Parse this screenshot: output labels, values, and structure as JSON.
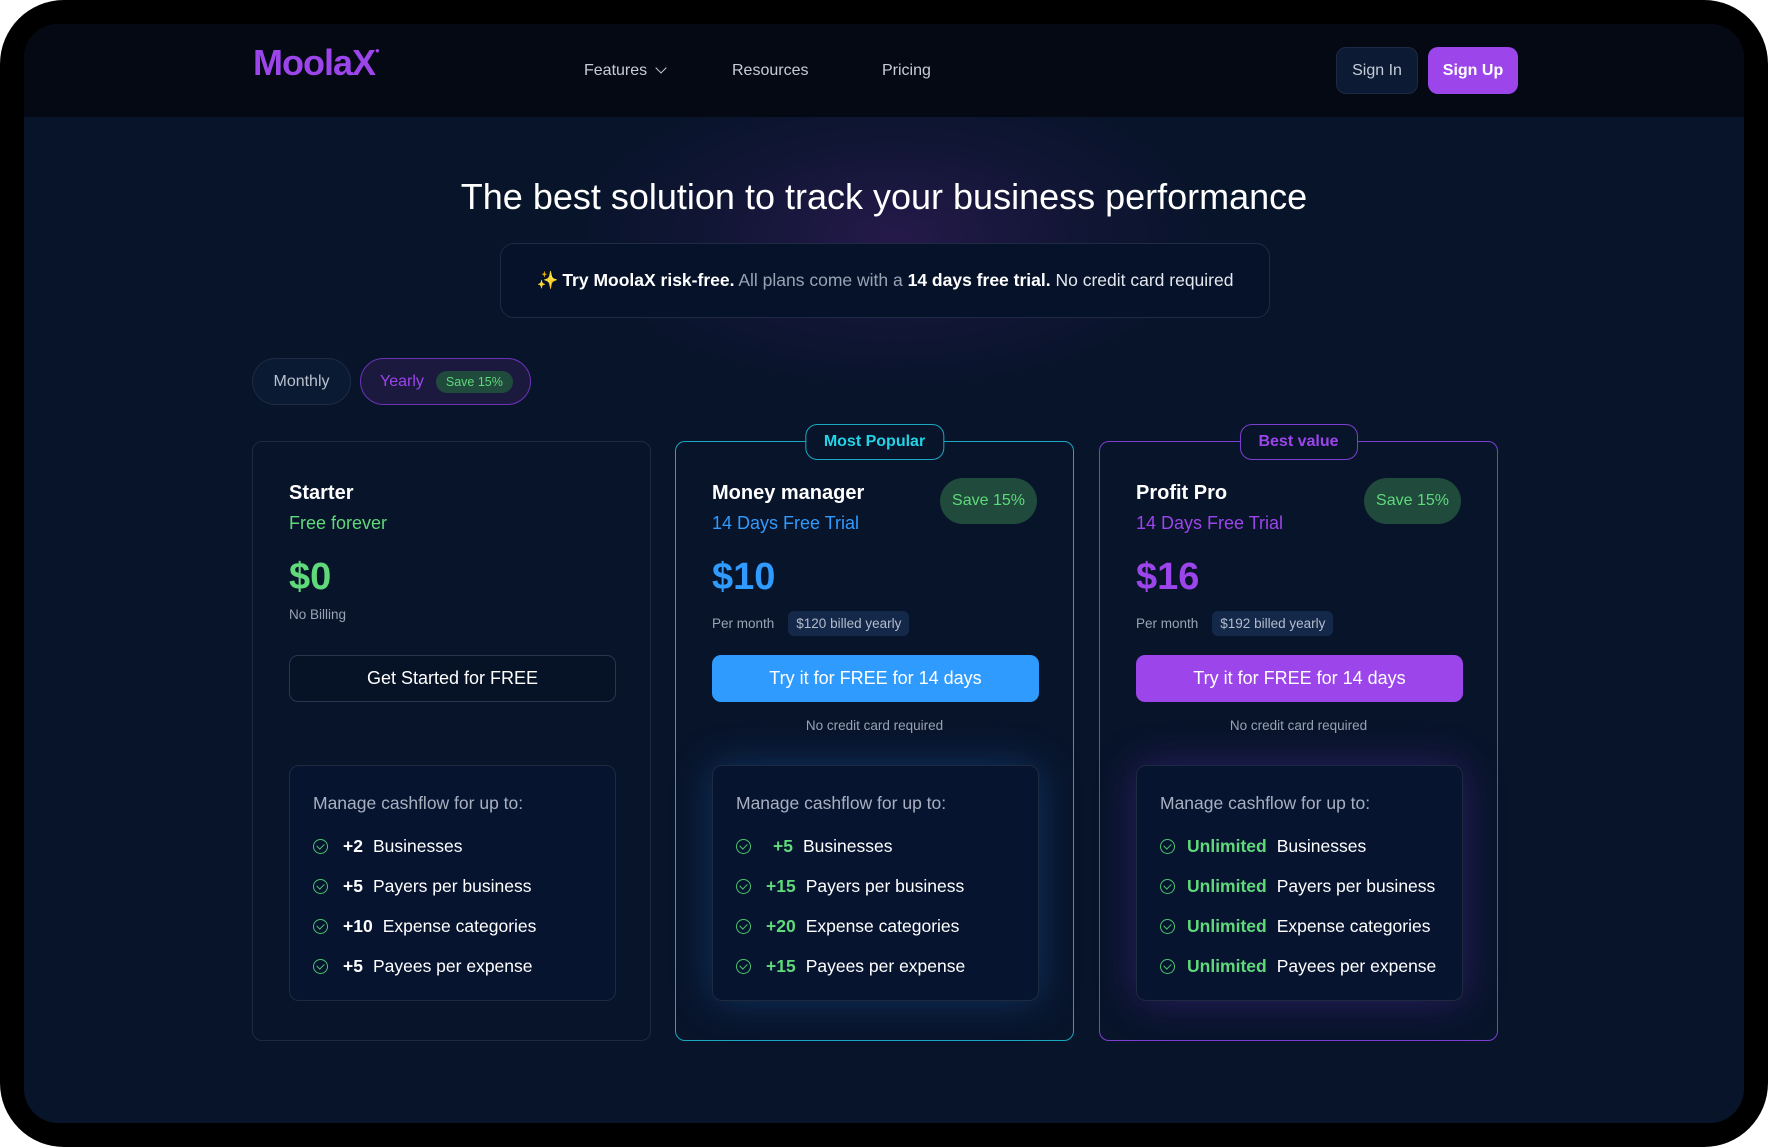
{
  "app": {
    "logo": "MoolaX"
  },
  "nav": {
    "items": [
      {
        "label": "Features",
        "has_dropdown": true
      },
      {
        "label": "Resources"
      },
      {
        "label": "Pricing"
      }
    ],
    "sign_in": "Sign In",
    "sign_up": "Sign Up"
  },
  "hero": {
    "title": "The best solution to track your business performance",
    "trial_banner": {
      "icon": "sparkles-icon",
      "bold1": "Try MoolaX risk-free.",
      "text1": " All plans come with a ",
      "bold2": "14 days free trial.",
      "text2": " No credit card required"
    }
  },
  "billing_toggle": {
    "monthly": "Monthly",
    "yearly": "Yearly",
    "yearly_save": "Save 15%",
    "selected": "Yearly"
  },
  "colors": {
    "brand_purple": "#9b45ea",
    "accent_blue": "#2f9bff",
    "accent_cyan": "#22d3e6",
    "success_green": "#5fd97a",
    "background": "#08142a"
  },
  "plans": [
    {
      "name": "Starter",
      "subtitle": "Free forever",
      "price": "$0",
      "price_note": "No Billing",
      "cta": "Get Started for FREE",
      "features_heading": "Manage cashflow for up to:",
      "features": [
        {
          "qty": "+2",
          "label": "Businesses"
        },
        {
          "qty": "+5",
          "label": "Payers per business"
        },
        {
          "qty": "+10",
          "label": "Expense categories"
        },
        {
          "qty": "+5",
          "label": "Payees per expense"
        }
      ]
    },
    {
      "name": "Money manager",
      "badge": "Most Popular",
      "subtitle": "14 Days Free Trial",
      "save": "Save 15%",
      "price": "$10",
      "price_note": "Per month",
      "billed": "$120 billed yearly",
      "cta": "Try it for FREE for 14 days",
      "cta_note": "No credit card required",
      "features_heading": "Manage cashflow for up to:",
      "features": [
        {
          "qty": "+5",
          "label": "Businesses"
        },
        {
          "qty": "+15",
          "label": "Payers per business"
        },
        {
          "qty": "+20",
          "label": "Expense categories"
        },
        {
          "qty": "+15",
          "label": "Payees per expense"
        }
      ]
    },
    {
      "name": "Profit Pro",
      "badge": "Best value",
      "subtitle": "14 Days Free Trial",
      "save": "Save 15%",
      "price": "$16",
      "price_note": "Per month",
      "billed": "$192 billed yearly",
      "cta": "Try it for FREE for 14 days",
      "cta_note": "No credit card required",
      "features_heading": "Manage cashflow for up to:",
      "features": [
        {
          "qty": "Unlimited",
          "label": "Businesses"
        },
        {
          "qty": "Unlimited",
          "label": "Payers per business"
        },
        {
          "qty": "Unlimited",
          "label": "Expense categories"
        },
        {
          "qty": "Unlimited",
          "label": "Payees per expense"
        }
      ]
    }
  ]
}
